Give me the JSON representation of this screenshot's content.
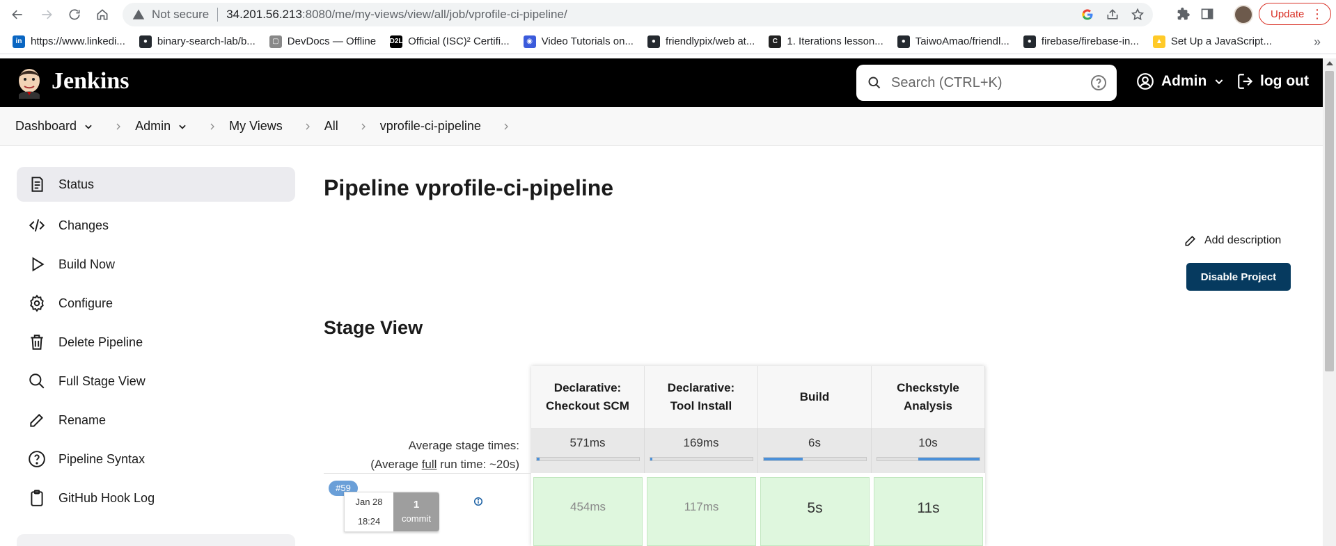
{
  "browser": {
    "insecure_label": "Not secure",
    "url_host": "34.201.56.213",
    "url_path": ":8080/me/my-views/view/all/job/vprofile-ci-pipeline/",
    "update_label": "Update",
    "bookmarks": [
      {
        "label": "https://www.linkedi...",
        "icon": "linkedin-icon",
        "color": "#0a66c2"
      },
      {
        "label": "binary-search-lab/b...",
        "icon": "github-icon",
        "color": "#24292f"
      },
      {
        "label": "DevDocs — Offline",
        "icon": "devdocs-icon",
        "color": "#888888"
      },
      {
        "label": "Official (ISC)² Certifi...",
        "icon": "d2l-icon",
        "color": "#000000"
      },
      {
        "label": "Video Tutorials on...",
        "icon": "globe-icon",
        "color": "#3b5bdb"
      },
      {
        "label": "friendlypix/web at...",
        "icon": "github-icon",
        "color": "#24292f"
      },
      {
        "label": "1. Iterations lesson...",
        "icon": "c-icon",
        "color": "#222222"
      },
      {
        "label": "TaiwoAmao/friendl...",
        "icon": "github-icon",
        "color": "#24292f"
      },
      {
        "label": "firebase/firebase-in...",
        "icon": "github-icon",
        "color": "#24292f"
      },
      {
        "label": "Set Up a JavaScript...",
        "icon": "firebase-icon",
        "color": "#ffca28"
      }
    ],
    "more_label": "»"
  },
  "jenkins": {
    "title": "Jenkins",
    "search_placeholder": "Search (CTRL+K)",
    "user": "Admin",
    "logout": "log out"
  },
  "breadcrumb": [
    "Dashboard",
    "Admin",
    "My Views",
    "All",
    "vprofile-ci-pipeline"
  ],
  "sidebar": {
    "items": [
      {
        "label": "Status",
        "icon": "status-icon"
      },
      {
        "label": "Changes",
        "icon": "code-icon"
      },
      {
        "label": "Build Now",
        "icon": "play-icon"
      },
      {
        "label": "Configure",
        "icon": "gear-icon"
      },
      {
        "label": "Delete Pipeline",
        "icon": "trash-icon"
      },
      {
        "label": "Full Stage View",
        "icon": "search-icon"
      },
      {
        "label": "Rename",
        "icon": "pencil-icon"
      },
      {
        "label": "Pipeline Syntax",
        "icon": "help-icon"
      },
      {
        "label": "GitHub Hook Log",
        "icon": "clipboard-icon"
      }
    ]
  },
  "main": {
    "title": "Pipeline vprofile-ci-pipeline",
    "add_description": "Add description",
    "disable_button": "Disable Project",
    "stage_view_title": "Stage View",
    "avg_label_line1": "Average stage times:",
    "avg_label_pre": "(Average ",
    "avg_label_full": "full",
    "avg_label_post": " run time: ~20s)"
  },
  "stages": [
    {
      "name_line1": "Declarative:",
      "name_line2": "Checkout SCM",
      "avg": "571ms",
      "fill_start": 0.0,
      "fill_end": 0.03
    },
    {
      "name_line1": "Declarative:",
      "name_line2": "Tool Install",
      "avg": "169ms",
      "fill_start": 0.0,
      "fill_end": 0.02
    },
    {
      "name_line1": "Build",
      "name_line2": "",
      "avg": "6s",
      "fill_start": 0.0,
      "fill_end": 0.38
    },
    {
      "name_line1": "Checkstyle",
      "name_line2": "Analysis",
      "avg": "10s",
      "fill_start": 0.4,
      "fill_end": 1.0
    }
  ],
  "runs": [
    {
      "badge": "#59",
      "date": "Jan 28",
      "time": "18:24",
      "commit_count": "1",
      "commit_label": "commit",
      "stage_times": [
        "454ms",
        "117ms",
        "5s",
        "11s"
      ]
    }
  ],
  "colors": {
    "header_bg": "#000000",
    "disable_button_bg": "#063a5f",
    "success_cell_bg": "#dff7de",
    "progress_fill": "#4a90d9",
    "run_badge": "#6a9fd8"
  }
}
